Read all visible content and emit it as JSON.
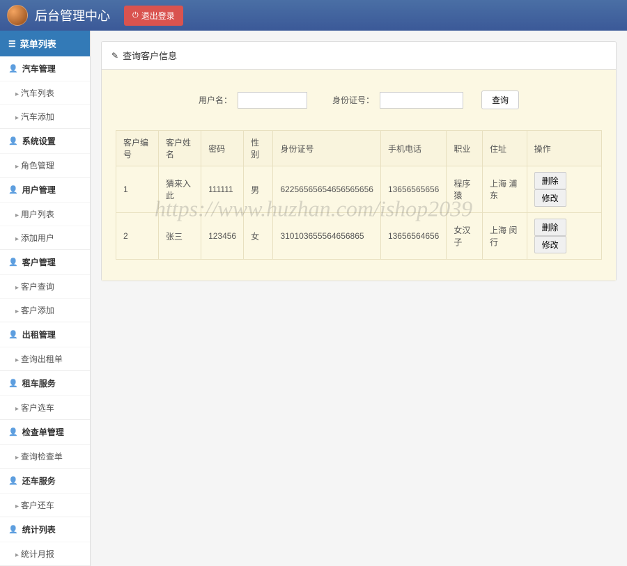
{
  "header": {
    "title": "后台管理中心",
    "logout_label": "退出登录"
  },
  "sidebar": {
    "header": "菜单列表",
    "sections": [
      {
        "title": "汽车管理",
        "items": [
          "汽车列表",
          "汽车添加"
        ]
      },
      {
        "title": "系统设置",
        "items": [
          "角色管理"
        ]
      },
      {
        "title": "用户管理",
        "items": [
          "用户列表",
          "添加用户"
        ]
      },
      {
        "title": "客户管理",
        "items": [
          "客户查询",
          "客户添加"
        ]
      },
      {
        "title": "出租管理",
        "items": [
          "查询出租单"
        ]
      },
      {
        "title": "租车服务",
        "items": [
          "客户选车"
        ]
      },
      {
        "title": "检查单管理",
        "items": [
          "查询检查单"
        ]
      },
      {
        "title": "还车服务",
        "items": [
          "客户还车"
        ]
      },
      {
        "title": "统计列表",
        "items": [
          "统计月报"
        ]
      }
    ]
  },
  "panel": {
    "title": "查询客户信息",
    "search": {
      "username_label": "用户名：",
      "username_value": "",
      "idcard_label": "身份证号：",
      "idcard_value": "",
      "button_label": "查询"
    },
    "table": {
      "headers": [
        "客户编号",
        "客户姓名",
        "密码",
        "性别",
        "身份证号",
        "手机电话",
        "职业",
        "住址",
        "操作"
      ],
      "rows": [
        {
          "id": "1",
          "name": "猜来入此",
          "password": "111111",
          "gender": "男",
          "idcard": "62256565654656565656",
          "phone": "13656565656",
          "job": "程序猿",
          "address": "上海 浦东"
        },
        {
          "id": "2",
          "name": "张三",
          "password": "123456",
          "gender": "女",
          "idcard": "310103655564656865",
          "phone": "13656564656",
          "job": "女汉子",
          "address": "上海 闵行"
        }
      ],
      "action_delete": "删除",
      "action_edit": "修改"
    }
  },
  "watermark": "https://www.huzhan.com/ishop2039"
}
